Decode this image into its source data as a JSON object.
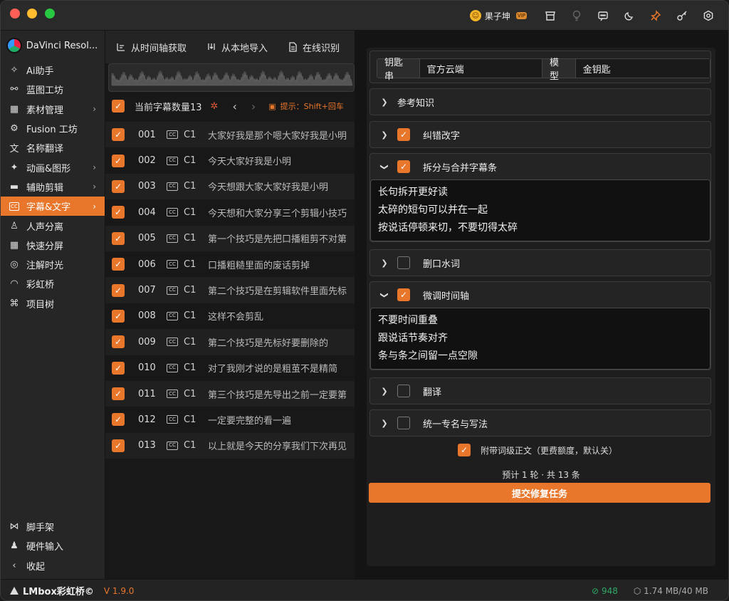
{
  "titlebar": {
    "user_name": "果子坤",
    "vip_badge": "VIP"
  },
  "sidebar": {
    "app_name": "DaVinci Resol...",
    "items": [
      {
        "label": "Ai助手",
        "icon": "sparkle-icon"
      },
      {
        "label": "蓝图工坊",
        "icon": "blueprint-icon"
      },
      {
        "label": "素材管理",
        "icon": "assets-icon",
        "has_submenu": true
      },
      {
        "label": "Fusion 工坊",
        "icon": "fusion-icon"
      },
      {
        "label": "名称翻译",
        "icon": "translate-icon"
      },
      {
        "label": "动画&图形",
        "icon": "animation-icon",
        "has_submenu": true
      },
      {
        "label": "辅助剪辑",
        "icon": "edit-icon",
        "has_submenu": true
      },
      {
        "label": "字幕&文字",
        "icon": "subtitle-icon",
        "has_submenu": true,
        "active": true
      },
      {
        "label": "人声分离",
        "icon": "voice-icon"
      },
      {
        "label": "快速分屏",
        "icon": "grid-icon"
      },
      {
        "label": "注解时光",
        "icon": "annotation-icon"
      },
      {
        "label": "彩虹桥",
        "icon": "rainbow-icon"
      },
      {
        "label": "项目树",
        "icon": "tree-icon"
      }
    ],
    "bottom_items": [
      {
        "label": "脚手架",
        "icon": "scaffold-icon"
      },
      {
        "label": "硬件输入",
        "icon": "joystick-icon"
      },
      {
        "label": "收起",
        "icon": "chevron-left-icon"
      }
    ]
  },
  "toolbar": {
    "from_timeline": "从时间轴获取",
    "from_local": "从本地导入",
    "online_recognize": "在线识别"
  },
  "subtitle_list": {
    "count_label": "当前字幕数量13",
    "hint": "提示：Shift+回车",
    "rows": [
      {
        "num": "001",
        "track": "C1",
        "text": "大家好我是那个嗯大家好我是小明"
      },
      {
        "num": "002",
        "track": "C1",
        "text": "今天大家好我是小明"
      },
      {
        "num": "003",
        "track": "C1",
        "text": "今天想跟大家大家好我是小明"
      },
      {
        "num": "004",
        "track": "C1",
        "text": "今天想和大家分享三个剪辑小技巧"
      },
      {
        "num": "005",
        "track": "C1",
        "text": "第一个技巧是先把口播粗剪不对第"
      },
      {
        "num": "006",
        "track": "C1",
        "text": "口播粗糙里面的废话剪掉"
      },
      {
        "num": "007",
        "track": "C1",
        "text": "第二个技巧是在剪辑软件里面先标"
      },
      {
        "num": "008",
        "track": "C1",
        "text": "这样不会剪乱"
      },
      {
        "num": "009",
        "track": "C1",
        "text": "第二个技巧是先标好要删除的"
      },
      {
        "num": "010",
        "track": "C1",
        "text": "对了我刚才说的是粗茧不是精简"
      },
      {
        "num": "011",
        "track": "C1",
        "text": "第三个技巧是先导出之前一定要第"
      },
      {
        "num": "012",
        "track": "C1",
        "text": "一定要完整的看一遍"
      },
      {
        "num": "013",
        "track": "C1",
        "text": "以上就是今天的分享我们下次再见"
      }
    ]
  },
  "repair": {
    "key_label": "钥匙串",
    "key_value": "官方云端",
    "model_label": "模型",
    "model_value": "金钥匙",
    "sections": {
      "reference": {
        "label": "参考知识"
      },
      "correct": {
        "label": "纠错改字",
        "checked": true
      },
      "split": {
        "label": "拆分与合并字幕条",
        "checked": true,
        "lines": [
          "长句拆开更好读",
          "太碎的短句可以并在一起",
          "按说话停顿来切，不要切得太碎"
        ]
      },
      "filler": {
        "label": "删口水词",
        "checked": false
      },
      "timing": {
        "label": "微调时间轴",
        "checked": true,
        "lines": [
          "不要时间重叠",
          "跟说话节奏对齐",
          "条与条之间留一点空隙"
        ]
      },
      "translate": {
        "label": "翻译",
        "checked": false
      },
      "names": {
        "label": "统一专名与写法",
        "checked": false
      }
    },
    "extra_option": "附带词级正文（更费额度，默认关）",
    "estimate": "预计 1 轮 · 共 13 条",
    "submit": "提交修复任务"
  },
  "status": {
    "brand": "LMbox彩虹桥©",
    "version": "V 1.9.0",
    "count": "948",
    "memory": "1.74 MB/40 MB"
  },
  "colors": {
    "accent": "#e8762b",
    "count_green": "#2fa866"
  }
}
